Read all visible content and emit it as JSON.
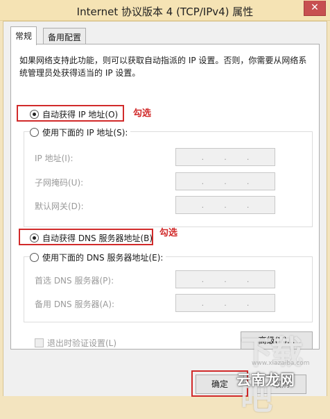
{
  "window": {
    "title": "Internet 协议版本 4 (TCP/IPv4) 属性",
    "close_label": "✕"
  },
  "tabs": [
    {
      "label": "常规"
    },
    {
      "label": "备用配置"
    }
  ],
  "description": "如果网络支持此功能，则可以获取自动指派的 IP 设置。否则，你需要从网络系统管理员处获得适当的 IP 设置。",
  "ip_section": {
    "auto_label": "自动获得 IP 地址(O)",
    "manual_label": "使用下面的 IP 地址(S):",
    "fields": [
      {
        "label": "IP 地址(I):"
      },
      {
        "label": "子网掩码(U):"
      },
      {
        "label": "默认网关(D):"
      }
    ]
  },
  "dns_section": {
    "auto_label": "自动获得 DNS 服务器地址(B)",
    "manual_label": "使用下面的 DNS 服务器地址(E):",
    "fields": [
      {
        "label": "首选 DNS 服务器(P):"
      },
      {
        "label": "备用 DNS 服务器(A):"
      }
    ]
  },
  "annotations": {
    "check_mark_1": "勾选",
    "check_mark_2": "勾选"
  },
  "ip_dot": ".",
  "validate_label": "退出时验证设置(L)",
  "advanced_label": "高级(V)...",
  "ok_label": "确定",
  "cancel_label": "取消",
  "watermark": {
    "brand": "下载吧",
    "site_main": "www.xiazaiba.com",
    "site_overlay": "云南龙网"
  },
  "colors": {
    "annotation_red": "#d12a2a",
    "title_bar": "#f5e3b4"
  }
}
